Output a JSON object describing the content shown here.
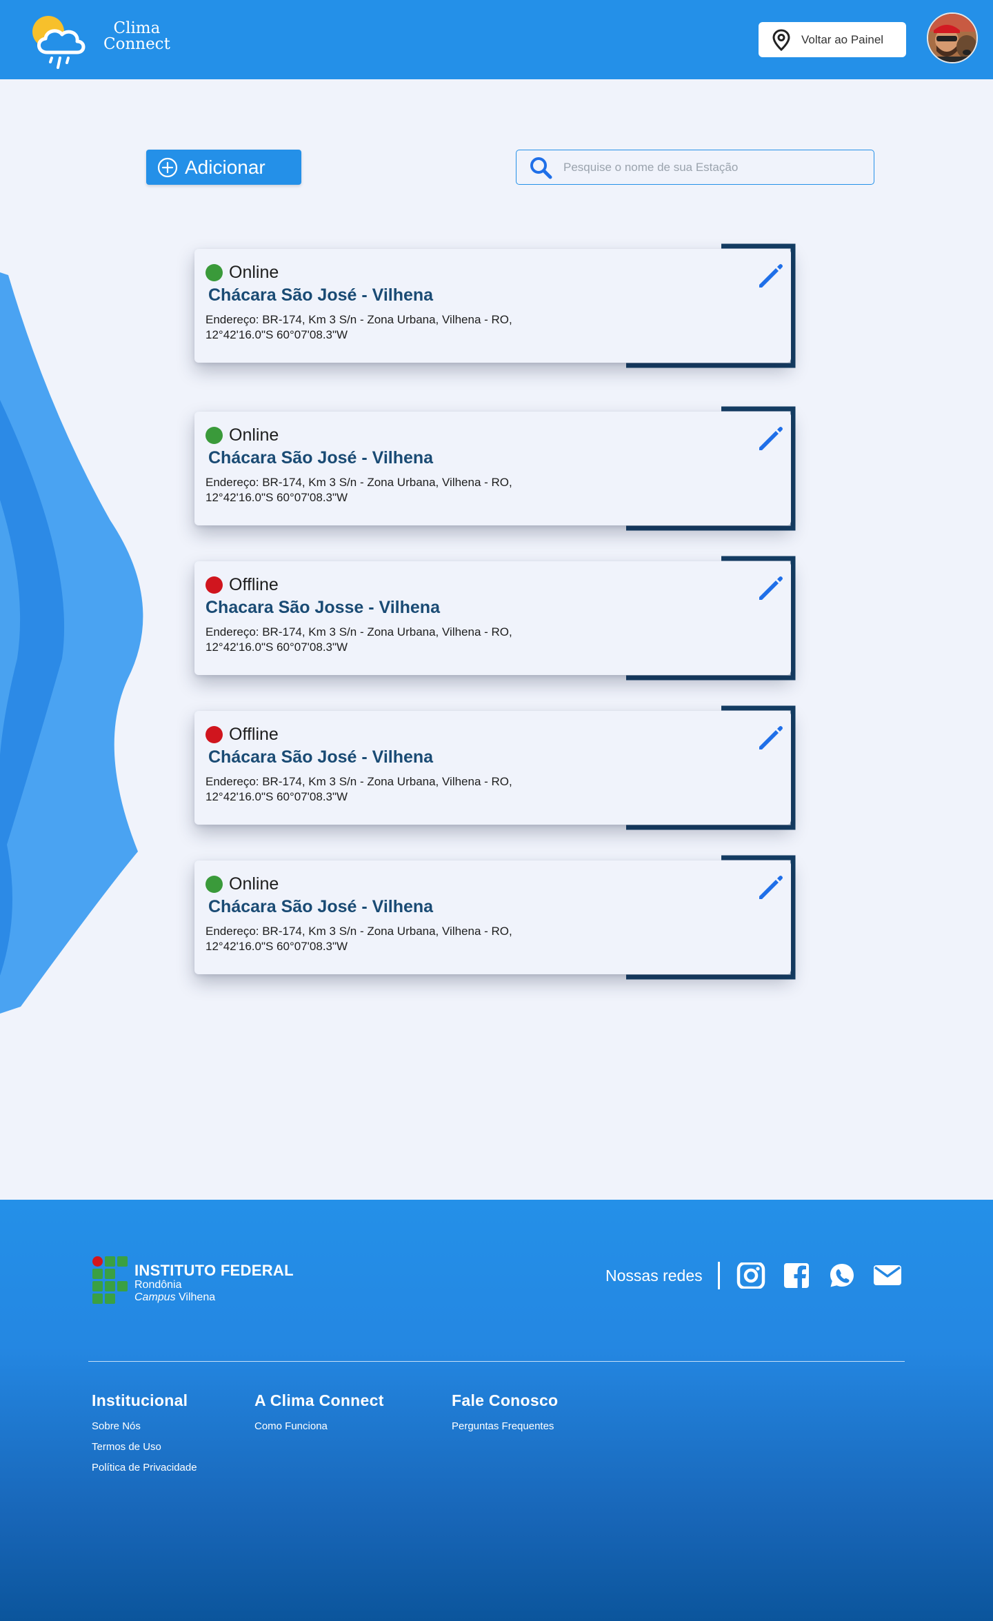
{
  "header": {
    "brand_line1": "Clima",
    "brand_line2": "Connect",
    "back_label": "Voltar ao Painel"
  },
  "toolbar": {
    "add_label": "Adicionar",
    "search_placeholder": "Pesquise o nome de sua Estação"
  },
  "colors": {
    "primary": "#2490e8",
    "online": "#3a9a3a",
    "offline": "#d0151e",
    "station_name": "#1a4b74",
    "edit_icon": "#1f6fe8"
  },
  "stations": [
    {
      "status": "Online",
      "name": "Chácara São José - Vilhena",
      "address": "Endereço:  BR-174, Km 3 S/n - Zona Urbana, Vilhena - RO,  12°42'16.0\"S 60°07'08.3\"W"
    },
    {
      "status": "Online",
      "name": "Chácara São José - Vilhena",
      "address": "Endereço:  BR-174, Km 3 S/n - Zona Urbana, Vilhena - RO,  12°42'16.0\"S 60°07'08.3\"W"
    },
    {
      "status": "Offline",
      "name": "Chacara São Josse - Vilhena",
      "address": "Endereço:  BR-174, Km 3 S/n - Zona Urbana, Vilhena - RO, 12°42'16.0\"S 60°07'08.3\"W"
    },
    {
      "status": "Offline",
      "name": "Chácara São José - Vilhena",
      "address": "Endereço:  BR-174, Km 3 S/n - Zona Urbana, Vilhena - RO, 12°42'16.0\"S 60°07'08.3\"W"
    },
    {
      "status": "Online",
      "name": "Chácara São José - Vilhena",
      "address": "Endereço:  BR-174, Km 3 S/n - Zona Urbana, Vilhena - RO, 12°42'16.0\"S 60°07'08.3\"W"
    }
  ],
  "footer": {
    "institute_title": "INSTITUTO FEDERAL",
    "institute_state": "Rondônia",
    "institute_campus_word": "Campus",
    "institute_campus_city": "Vilhena",
    "socials_label": "Nossas redes",
    "social_icons": [
      "instagram-icon",
      "facebook-icon",
      "whatsapp-icon",
      "mail-icon"
    ],
    "columns": [
      {
        "title": "Institucional",
        "links": [
          "Sobre Nós",
          "Termos de Uso",
          "Política de Privacidade"
        ]
      },
      {
        "title": "A Clima Connect",
        "links": [
          "Como Funciona"
        ]
      },
      {
        "title": "Fale Conosco",
        "links": [
          "Perguntas Frequentes"
        ]
      }
    ]
  }
}
